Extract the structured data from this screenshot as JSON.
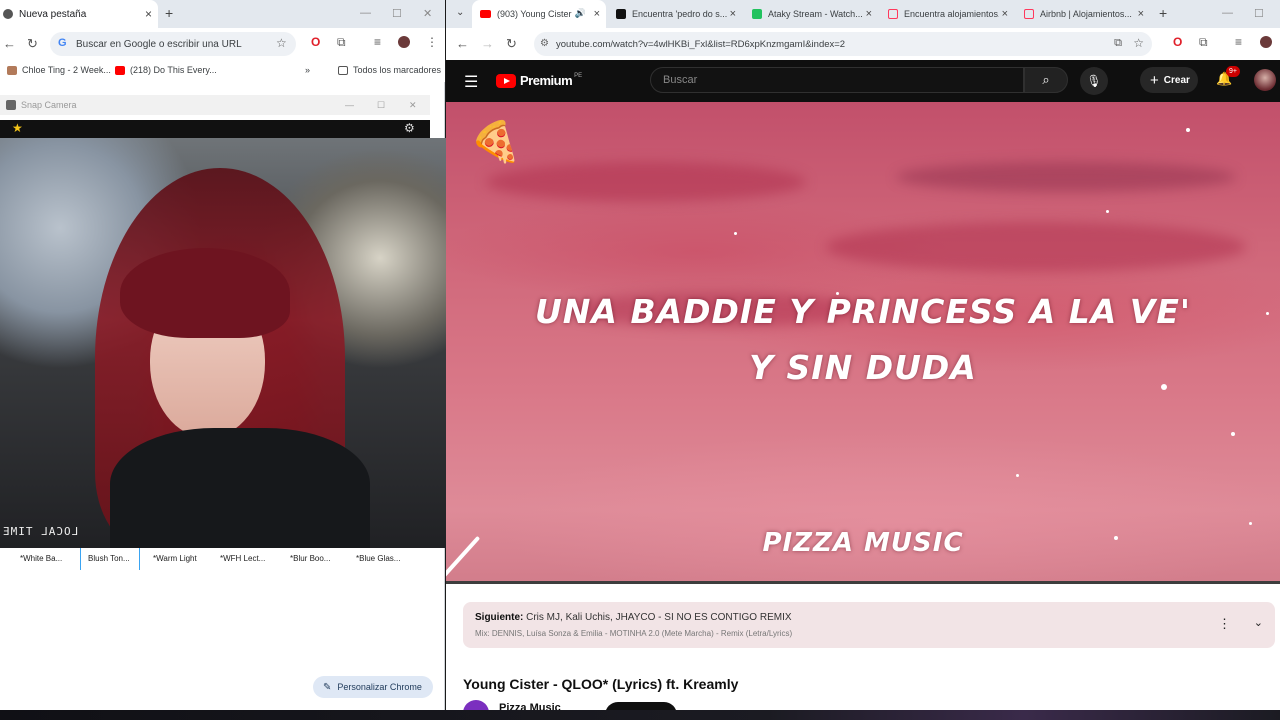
{
  "left_browser": {
    "tab_title": "Nueva pestaña",
    "omnibox_placeholder": "Buscar en Google o escribir una URL",
    "bookmarks": [
      {
        "label": "Chloe Ting - 2 Week..."
      },
      {
        "label": "(218) Do This Every..."
      }
    ],
    "all_bookmarks": "Todos los marcadores",
    "customize_label": "Personalizar Chrome"
  },
  "snap_camera": {
    "title": "Snap Camera",
    "overlay_text": "LOCAL TIME",
    "lenses": [
      "*White Ba...",
      "Blush Ton...",
      "*Warm Light",
      "*WFH Lect...",
      "*Blur Boo...",
      "*Blue Glas..."
    ]
  },
  "right_browser": {
    "tabs": [
      {
        "label": "(903) Young Cister"
      },
      {
        "label": "Encuentra 'pedro do s..."
      },
      {
        "label": "Ataky Stream - Watch..."
      },
      {
        "label": "Encuentra alojamientos..."
      },
      {
        "label": "Airbnb | Alojamientos..."
      }
    ],
    "url": "youtube.com/watch?v=4wlHKBi_Fxl&list=RD6xpKnzmgamI&index=2"
  },
  "youtube": {
    "brand": "Premium",
    "country": "PE",
    "search_placeholder": "Buscar",
    "create_label": "Crear",
    "notif_badge": "9+",
    "lyric_line1": "UNA BADDIE Y PRINCESS A LA VE'",
    "lyric_line2": "Y SIN DUDA",
    "watermark": "PIZZA MUSIC",
    "next_label": "Siguiente:",
    "next_title": "Cris MJ, Kali Uchis, JHAYCO - SI NO ES CONTIGO REMIX",
    "next_mix": "Mix: DENNIS, Luísa Sonza & Emilia - MOTINHA 2.0 (Mete Marcha) - Remix (Letra/Lyrics)",
    "video_title": "Young Cister - QLOO* (Lyrics) ft. Kreamly",
    "channel_name": "Pizza Music"
  },
  "colors": {
    "yt_red": "#ff0000",
    "yt_dark": "#0f0f0f",
    "chrome_tabstrip": "#e3e8ee"
  }
}
